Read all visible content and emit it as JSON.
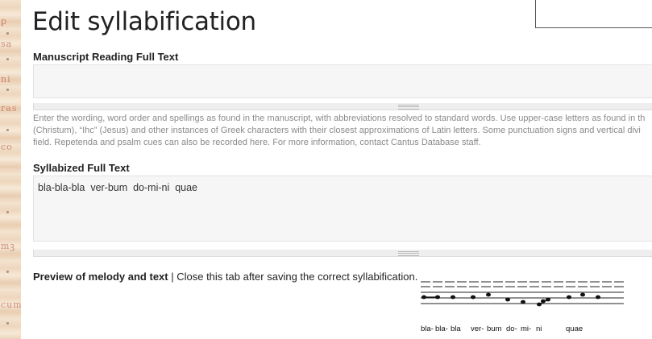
{
  "page_title": "Edit syllabification",
  "manuscript": {
    "label": "Manuscript Reading Full Text",
    "value": "",
    "help_lines": [
      "Enter the wording, word order and spellings as found in the manuscript, with abbreviations resolved to standard words. Use upper-case letters as found in th",
      "(Christum), “Ihc” (Jesus) and other instances of Greek characters with their closest approximations of Latin letters. Some punctuation signs and vertical divi",
      "field. Repetenda and psalm cues can also be recorded here. For more information, contact Cantus Database staff."
    ]
  },
  "syllabized": {
    "label": "Syllabized Full Text",
    "value": "bla-bla-bla  ver-bum  do-mi-ni  quae"
  },
  "preview": {
    "label": "Preview of melody and text",
    "separator": " | ",
    "note": "Close this tab after saving the correct syllabification.",
    "syllables": [
      "bla-",
      "bla-",
      "bla",
      "ver-",
      "bum",
      "do-",
      "mi-",
      "ni",
      "quae"
    ]
  }
}
